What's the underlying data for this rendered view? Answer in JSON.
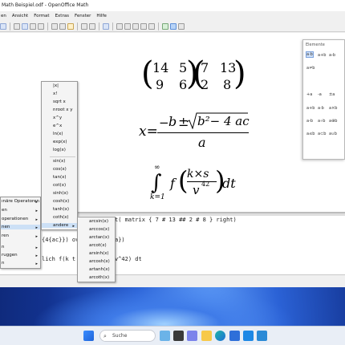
{
  "window": {
    "title": "Math Beispiel.odf - OpenOffice Math"
  },
  "menubar": [
    "en",
    "Ansicht",
    "Format",
    "Extras",
    "Fenster",
    "Hilfe"
  ],
  "formula": {
    "matrix_a": [
      "14",
      "5",
      "9",
      "6"
    ],
    "matrix_b": [
      "7",
      "13",
      "2",
      "8"
    ],
    "quad_lhs": "x=",
    "quad_num_minus": "−",
    "quad_num_b": "b",
    "quad_num_pm": "±",
    "quad_sqrt_body": "b²− 4 ac",
    "quad_den": "a",
    "integral_upper": "∞",
    "integral_lower": "k=1",
    "integral_body_f": "f",
    "integral_frac_num": "k×s",
    "integral_frac_den": "v",
    "integral_frac_den_exp": "42",
    "integral_dt": "dt"
  },
  "editor": {
    "line1": "t( matrix { 7 # 13 ## 2 # 8 } right)",
    "line2": "{4{ac}}) ov",
    "line2b": "a})",
    "line3": "lich f(k t",
    "line3b": "v^42) dt"
  },
  "elements_panel": {
    "title": "Elemente",
    "row1": [
      "a·b",
      "a+b",
      "a-b",
      "a≠b"
    ],
    "row2": [
      "+a",
      "-a",
      "±a",
      "∓a"
    ],
    "row3": [
      "a+b",
      "a·b",
      "a×b",
      "a÷b"
    ],
    "row4": [
      "a-b",
      "a∘b",
      "a⊕b",
      "a∧b"
    ],
    "row5": [
      "a≤b",
      "a⊂b",
      "a∪b",
      "∫"
    ]
  },
  "left_menu": {
    "items": [
      "ınäre Operatoren",
      "en",
      "operationen",
      "nen",
      "ren",
      "",
      "n",
      "ruggen",
      "n"
    ],
    "highlight_index": 3
  },
  "functions_menu": {
    "items": [
      "|x|",
      "x!",
      "sqrt x",
      "nroot x y",
      "x^y",
      "e^x",
      "ln(x)",
      "exp(x)",
      "log(x)",
      "sin(x)",
      "cos(x)",
      "tan(x)",
      "cot(x)",
      "sinh(x)",
      "cosh(x)",
      "tanh(x)",
      "coth(x)",
      "andere"
    ],
    "highlight": "andere"
  },
  "andere_menu": {
    "items": [
      "arcsin(x)",
      "arccos(x)",
      "arctan(x)",
      "arcot(x)",
      "arsinh(x)",
      "arcosh(x)",
      "artanh(x)",
      "arcoth(x)"
    ]
  },
  "taskbar": {
    "search_label": "Suche"
  },
  "colors": {
    "accent": "#2b62d6",
    "menu_highlight": "#cce0f6"
  }
}
